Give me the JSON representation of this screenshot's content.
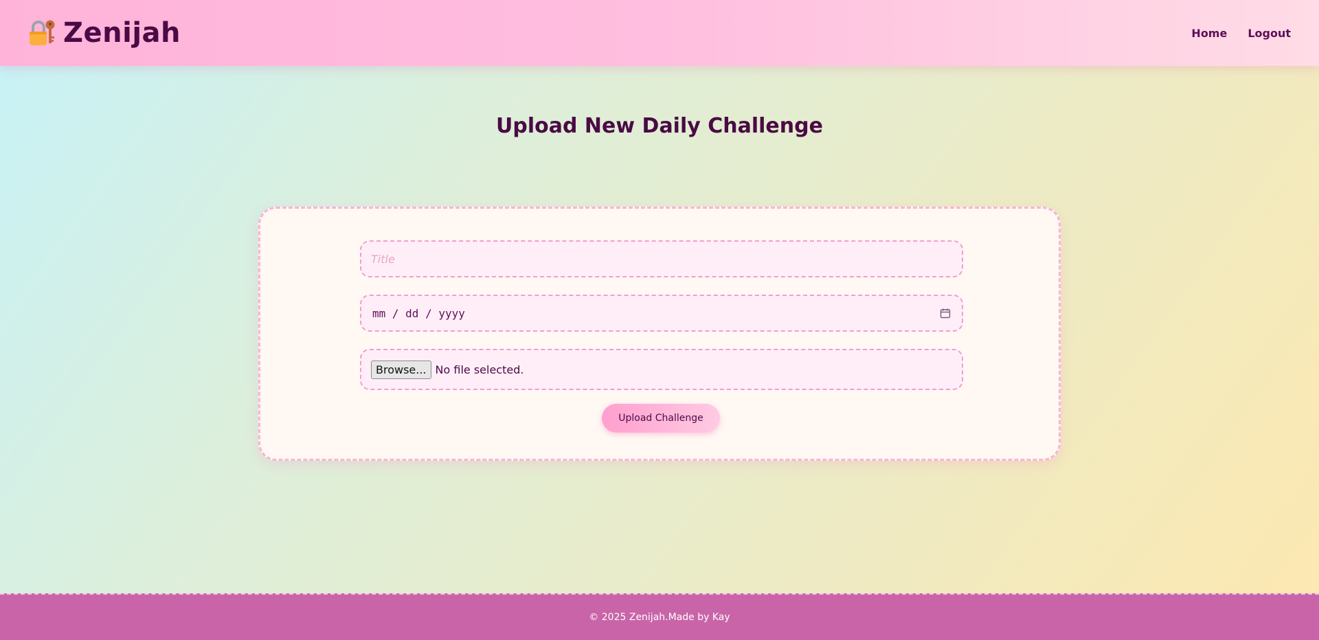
{
  "header": {
    "brand_name": "Zenijah",
    "brand_icon": "lock-with-key-icon",
    "nav": [
      {
        "label": "Home"
      },
      {
        "label": "Logout"
      }
    ]
  },
  "main": {
    "page_title": "Upload New Daily Challenge",
    "form": {
      "title_placeholder": "Title",
      "title_value": "",
      "date_placeholder": "mm / dd / yyyy",
      "date_icon": "calendar-icon",
      "file_button_label": "Browse...",
      "file_status": "No file selected.",
      "submit_label": "Upload Challenge"
    }
  },
  "footer": {
    "text": "© 2025 Zenijah.Made by Kay"
  },
  "colors": {
    "primary_text": "#4a0a45",
    "header_pink": "#ffb3d9",
    "footer_magenta": "#c964a8",
    "field_border": "#ef9ed0"
  }
}
